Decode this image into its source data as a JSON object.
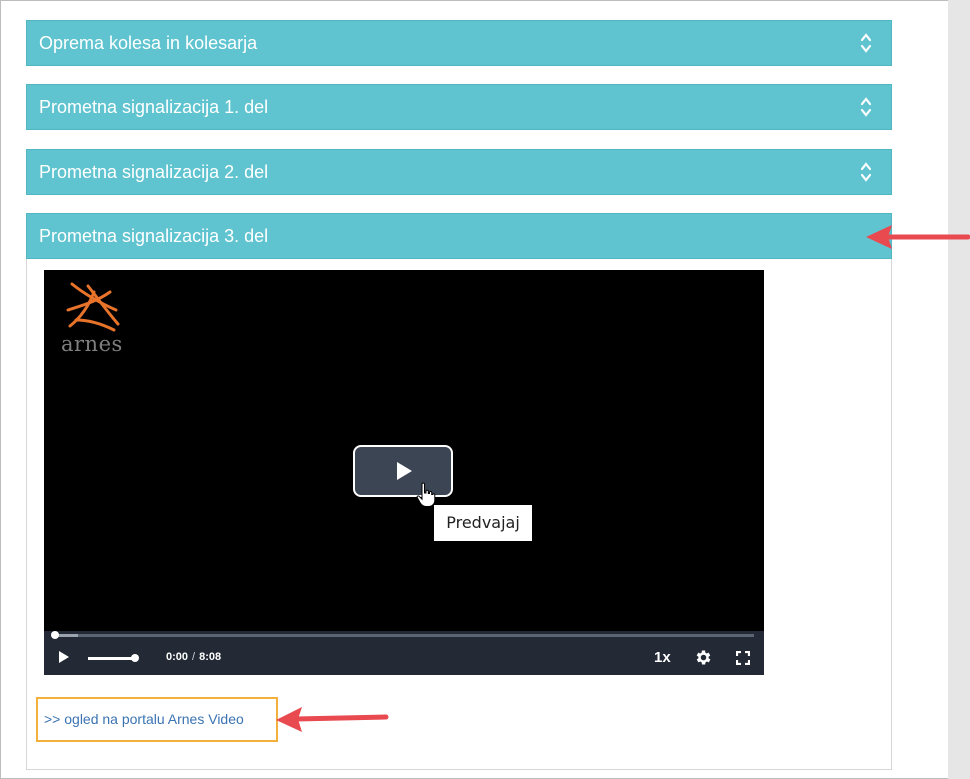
{
  "accordion": {
    "items": [
      {
        "label": "Oprema kolesa in kolesarja",
        "expanded": false
      },
      {
        "label": "Prometna signalizacija 1. del",
        "expanded": false
      },
      {
        "label": "Prometna signalizacija 2. del",
        "expanded": false
      },
      {
        "label": "Prometna signalizacija 3. del",
        "expanded": true
      }
    ]
  },
  "video": {
    "logo_text": "arnes",
    "play_tooltip": "Predvajaj",
    "current_time": "0:00",
    "time_separator": "/",
    "duration": "8:08",
    "speed": "1x",
    "volume_level": 1.0,
    "progress_fraction": 0.0
  },
  "link": {
    "text": ">> ogled na portalu Arnes Video"
  },
  "colors": {
    "accordion_bg": "#5fc4d0",
    "annotation_arrow": "#e84a4f",
    "highlight_box": "#f3b03c",
    "link": "#3b73b3"
  },
  "icons": [
    "chevron-up-down-icon",
    "play-icon",
    "cursor-hand-icon",
    "gear-icon",
    "fullscreen-icon",
    "arnes-logo"
  ]
}
